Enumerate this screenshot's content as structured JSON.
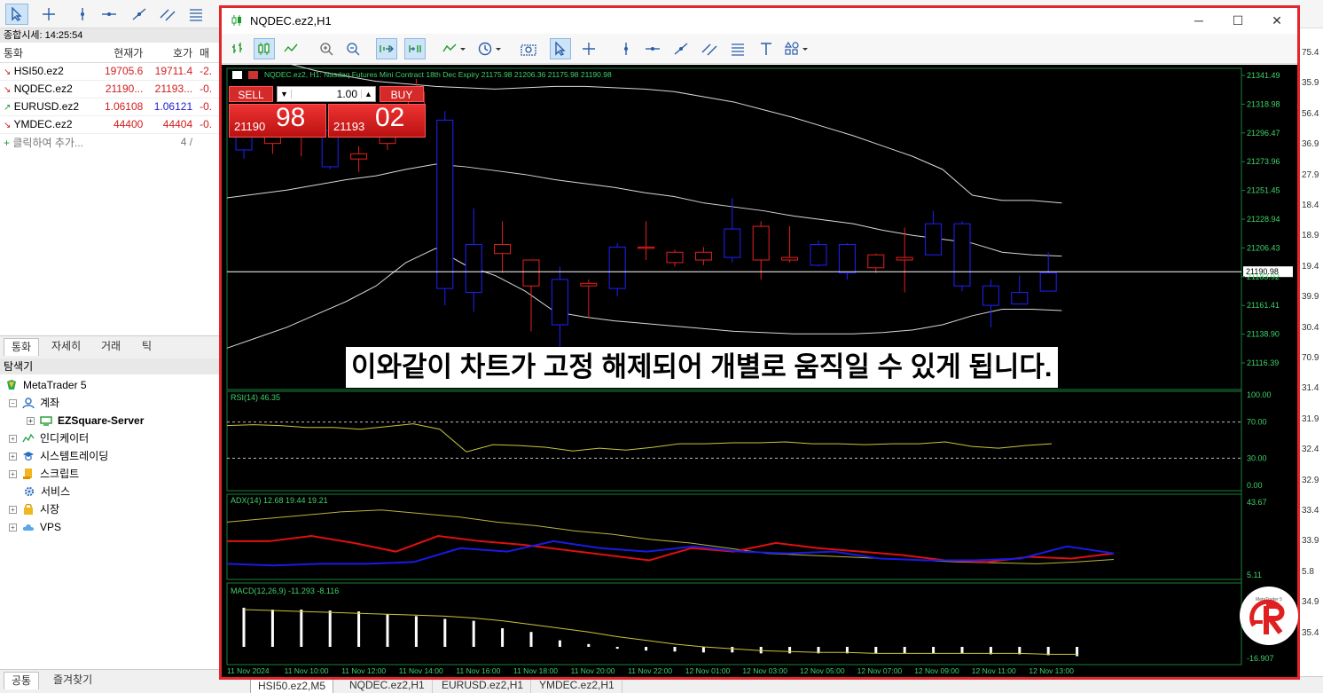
{
  "market_watch": {
    "title": "종합시세: 14:25:54",
    "headers": [
      "통화",
      "현재가",
      "호가",
      "매"
    ],
    "rows": [
      {
        "symbol": "HSI50.ez2",
        "bid": "19705.6",
        "ask": "19711.4",
        "change": "-2.",
        "dir": "down"
      },
      {
        "symbol": "NQDEC.ez2",
        "bid": "21190...",
        "ask": "21193...",
        "change": "-0.",
        "dir": "down"
      },
      {
        "symbol": "EURUSD.ez2",
        "bid": "1.06108",
        "ask": "1.06121",
        "change": "-0.",
        "dir": "up"
      },
      {
        "symbol": "YMDEC.ez2",
        "bid": "44400",
        "ask": "44404",
        "change": "-0.",
        "dir": "down"
      }
    ],
    "add_label": "클릭하여 추가...",
    "count": "4 /"
  },
  "mw_tabs": [
    "통화",
    "자세히",
    "거래",
    "틱"
  ],
  "navigator": {
    "title": "탐색기",
    "items": [
      "MetaTrader 5",
      "계좌",
      "EZSquare-Server",
      "인디케이터",
      "시스템트레이딩",
      "스크립트",
      "서비스",
      "시장",
      "VPS"
    ]
  },
  "nav_tabs": [
    "공통",
    "즐겨찾기"
  ],
  "bottom_tabs": [
    "HSI50.ez2,M5",
    "NQDEC.ez2,H1",
    "EURUSD.ez2,H1",
    "YMDEC.ez2,H1"
  ],
  "right_strip_values": [
    "75.4",
    "35.9",
    "56.4",
    "36.9",
    "27.9",
    "18.4",
    "18.9",
    "19.4",
    "39.9",
    "30.4",
    "70.9",
    "31.4",
    "31.9",
    "32.4",
    "32.9",
    "33.4",
    "33.9",
    "5.8",
    "34.9",
    "35.4"
  ],
  "chart_window": {
    "title": "NQDEC.ez2,H1",
    "info_line": "NQDEC.ez2, H1:  Nasdaq Futures Mini Contract 18th Dec Expiry  21175.98 21206.36 21175.98 21190.98",
    "trade": {
      "sell_label": "SELL",
      "buy_label": "BUY",
      "volume": "1.00",
      "sell_prefix": "21190",
      "sell_big": "98",
      "buy_prefix": "21193",
      "buy_big": "02"
    },
    "subtitle": "이와같이 차트가 고정 해제되어 개별로 움직일 수 있게 됩니다.",
    "logo_text": "MetaTrader 5"
  },
  "chart_data": [
    {
      "type": "candlestick",
      "title": "NQDEC.ez2, H1",
      "price_axis_ticks": [
        "21341.49",
        "21318.98",
        "21296.47",
        "21273.96",
        "21251.45",
        "21228.94",
        "21206.43",
        "21183.92",
        "21161.41",
        "21138.90",
        "21116.39"
      ],
      "price_min": 21100,
      "price_max": 21348,
      "current_price": "21190.98",
      "candles": [
        {
          "o": 21300,
          "h": 21310,
          "l": 21278,
          "c": 21285
        },
        {
          "o": 21290,
          "h": 21305,
          "l": 21282,
          "c": 21298
        },
        {
          "o": 21295,
          "h": 21310,
          "l": 21280,
          "c": 21300
        },
        {
          "o": 21300,
          "h": 21318,
          "l": 21270,
          "c": 21272
        },
        {
          "o": 21278,
          "h": 21288,
          "l": 21268,
          "c": 21282
        },
        {
          "o": 21290,
          "h": 21312,
          "l": 21285,
          "c": 21305
        },
        {
          "o": 21312,
          "h": 21340,
          "l": 21300,
          "c": 21330
        },
        {
          "o": 21308,
          "h": 21315,
          "l": 21165,
          "c": 21178
        },
        {
          "o": 21212,
          "h": 21240,
          "l": 21160,
          "c": 21175
        },
        {
          "o": 21205,
          "h": 21230,
          "l": 21190,
          "c": 21212
        },
        {
          "o": 21180,
          "h": 21200,
          "l": 21145,
          "c": 21200
        },
        {
          "o": 21185,
          "h": 21195,
          "l": 21125,
          "c": 21150
        },
        {
          "o": 21180,
          "h": 21185,
          "l": 21155,
          "c": 21182
        },
        {
          "o": 21210,
          "h": 21213,
          "l": 21172,
          "c": 21178
        },
        {
          "o": 21209,
          "h": 21230,
          "l": 21200,
          "c": 21210
        },
        {
          "o": 21198,
          "h": 21208,
          "l": 21195,
          "c": 21206
        },
        {
          "o": 21200,
          "h": 21210,
          "l": 21196,
          "c": 21206
        },
        {
          "o": 21224,
          "h": 21248,
          "l": 21198,
          "c": 21202
        },
        {
          "o": 21200,
          "h": 21230,
          "l": 21185,
          "c": 21226
        },
        {
          "o": 21200,
          "h": 21226,
          "l": 21198,
          "c": 21202
        },
        {
          "o": 21212,
          "h": 21215,
          "l": 21195,
          "c": 21196
        },
        {
          "o": 21212,
          "h": 21213,
          "l": 21185,
          "c": 21190
        },
        {
          "o": 21194,
          "h": 21205,
          "l": 21190,
          "c": 21204
        },
        {
          "o": 21200,
          "h": 21225,
          "l": 21175,
          "c": 21202
        },
        {
          "o": 21228,
          "h": 21238,
          "l": 21204,
          "c": 21204
        },
        {
          "o": 21228,
          "h": 21230,
          "l": 21176,
          "c": 21180
        },
        {
          "o": 21180,
          "h": 21185,
          "l": 21148,
          "c": 21165
        },
        {
          "o": 21175,
          "h": 21188,
          "l": 21172,
          "c": 21166
        },
        {
          "o": 21190,
          "h": 21206,
          "l": 21176,
          "c": 21176
        }
      ],
      "bb_upper": [
        21360,
        21358,
        21352,
        21346,
        21342,
        21338,
        21336,
        21334,
        21333,
        21332,
        21333,
        21334,
        21334,
        21333,
        21332,
        21330,
        21326,
        21322,
        21316,
        21310,
        21303,
        21296,
        21288,
        21280,
        21270,
        21250,
        21246,
        21246,
        21244
      ],
      "bb_mid": [
        21248,
        21251,
        21254,
        21258,
        21262,
        21265,
        21270,
        21274,
        21272,
        21269,
        21266,
        21262,
        21259,
        21256,
        21252,
        21249,
        21244,
        21241,
        21238,
        21234,
        21231,
        21228,
        21223,
        21219,
        21216,
        21213,
        21206,
        21204,
        21203
      ],
      "bb_lower": [
        21132,
        21140,
        21148,
        21158,
        21168,
        21180,
        21198,
        21209,
        21196,
        21188,
        21176,
        21160,
        21156,
        21153,
        21151,
        21149,
        21147,
        21145,
        21144,
        21143,
        21143,
        21143,
        21144,
        21146,
        21150,
        21157,
        21162,
        21162,
        21161
      ]
    },
    {
      "type": "line",
      "title": "RSI(14) 46.35",
      "ticks": [
        "100.00",
        "70.00",
        "30.00",
        "0.00"
      ],
      "ylim": [
        0,
        100
      ],
      "levels": [
        70,
        30
      ],
      "values": [
        66,
        67,
        66,
        64,
        64,
        62,
        65,
        68,
        62,
        37,
        45,
        44,
        42,
        38,
        41,
        39,
        42,
        46,
        46,
        47,
        47,
        48,
        46,
        46,
        45,
        46,
        46,
        48,
        43,
        41,
        44,
        46
      ]
    },
    {
      "type": "line",
      "title": "ADX(14) 12.68 19.44 19.21",
      "ticks": [
        "43.67",
        "5.11"
      ],
      "ylim": [
        0,
        45
      ],
      "series": [
        {
          "name": "ADX",
          "color": "#b8b340",
          "values": [
            32,
            34,
            36,
            38,
            39,
            37,
            35,
            32,
            30,
            27,
            25,
            22,
            20,
            17,
            14,
            13,
            12,
            11,
            10,
            9,
            8.5,
            8,
            9,
            10.5
          ]
        },
        {
          "name": "+DI",
          "color": "#e01010",
          "values": [
            21,
            21,
            24,
            20,
            15,
            24,
            21,
            19,
            16,
            13,
            10,
            17,
            15,
            20,
            17,
            15,
            13,
            10,
            9,
            12,
            11,
            14
          ]
        },
        {
          "name": "-DI",
          "color": "#1a1ae6",
          "values": [
            8,
            7,
            8,
            8,
            9,
            17,
            15,
            21,
            17,
            15,
            18,
            15,
            14,
            15,
            11,
            10,
            10,
            11,
            18,
            14
          ]
        }
      ]
    },
    {
      "type": "bar",
      "title": "MACD(12,26,9) -11.293 -8.116",
      "ticks": [
        "-16.907"
      ],
      "ylim": [
        -20,
        60
      ],
      "values": [
        42,
        40,
        40,
        39,
        38,
        35,
        33,
        30,
        28,
        20,
        16,
        7,
        3,
        -2,
        -4,
        -5,
        -6,
        -6,
        -7,
        -7,
        -7,
        -7,
        -7,
        -7,
        -7,
        -7,
        -8,
        -8,
        -9,
        -10
      ],
      "signal": [
        40,
        39,
        38,
        37,
        36,
        35,
        34,
        33,
        31,
        28,
        24,
        20,
        16,
        11,
        7,
        3,
        0,
        -2,
        -4,
        -5,
        -6,
        -6,
        -7,
        -7,
        -7,
        -7,
        -7,
        -7,
        -8,
        -8
      ]
    }
  ],
  "time_axis": [
    "11 Nov 2024",
    "11 Nov 10:00",
    "11 Nov 12:00",
    "11 Nov 14:00",
    "11 Nov 16:00",
    "11 Nov 18:00",
    "11 Nov 20:00",
    "11 Nov 22:00",
    "12 Nov 01:00",
    "12 Nov 03:00",
    "12 Nov 05:00",
    "12 Nov 07:00",
    "12 Nov 09:00",
    "12 Nov 11:00",
    "12 Nov 13:00"
  ]
}
